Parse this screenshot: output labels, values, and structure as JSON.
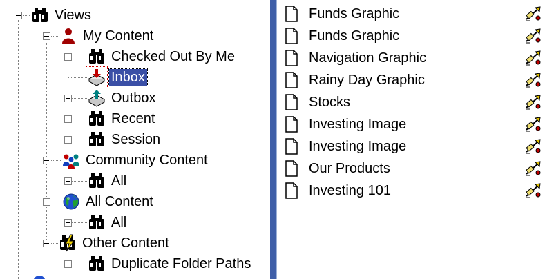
{
  "tree": {
    "views": "Views",
    "my_content": "My Content",
    "checked_out": "Checked Out By Me",
    "inbox": "Inbox",
    "outbox": "Outbox",
    "recent": "Recent",
    "session": "Session",
    "community_content": "Community Content",
    "community_all": "All",
    "all_content": "All Content",
    "all_content_all": "All",
    "other_content": "Other Content",
    "duplicate_folder_paths": "Duplicate Folder Paths"
  },
  "list": {
    "items": [
      "Funds Graphic",
      "Funds Graphic",
      "Navigation Graphic",
      "Rainy Day Graphic",
      "Stocks",
      "Investing Image",
      "Investing Image",
      "Our Products",
      "Investing 101"
    ]
  },
  "colors": {
    "selection": "#3a4fa6",
    "splitter": "#3f5fa8"
  }
}
